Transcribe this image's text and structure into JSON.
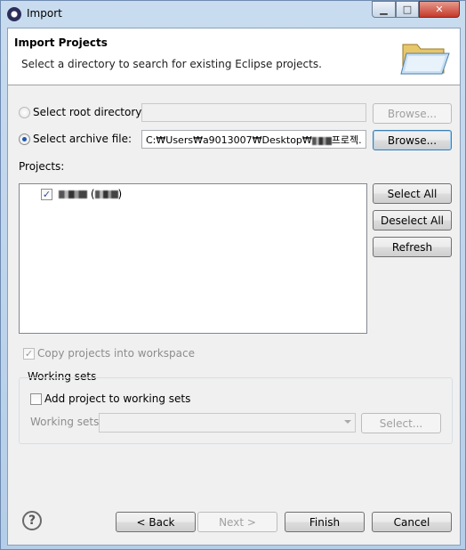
{
  "window": {
    "title": "Import"
  },
  "banner": {
    "title": "Import Projects",
    "description": "Select a directory to search for existing Eclipse projects."
  },
  "source": {
    "root_label": "Select root directory:",
    "root_value": "",
    "archive_label": "Select archive file:",
    "archive_value": "C:₩Users₩a9013007₩Desktop₩",
    "archive_value_suffix": "프로젝.",
    "browse_label": "Browse..."
  },
  "projects": {
    "label": "Projects:",
    "items": [
      {
        "checked": true,
        "name": "(",
        "name_suffix": ")"
      }
    ],
    "select_all": "Select All",
    "deselect_all": "Deselect All",
    "refresh": "Refresh"
  },
  "options": {
    "copy_label": "Copy projects into workspace"
  },
  "working_sets": {
    "group_label": "Working sets",
    "add_label": "Add project to working sets",
    "field_label": "Working sets:",
    "select_button": "Select..."
  },
  "footer": {
    "back": "< Back",
    "next": "Next >",
    "finish": "Finish",
    "cancel": "Cancel",
    "help_glyph": "?"
  }
}
